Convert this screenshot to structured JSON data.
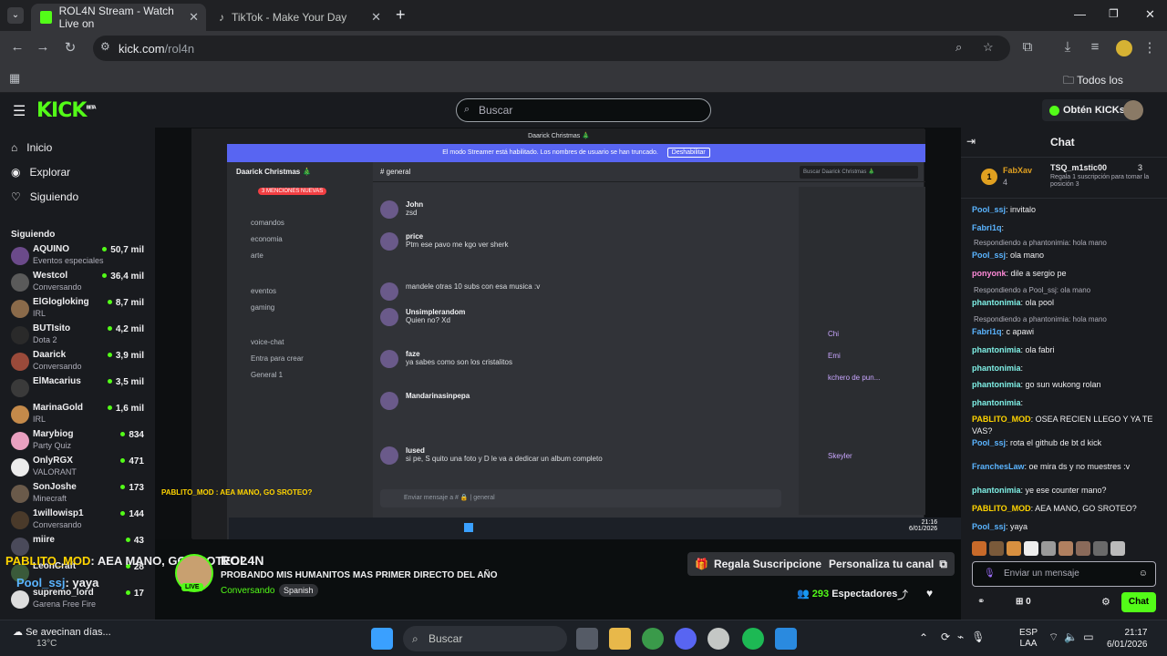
{
  "browser": {
    "tabs": [
      {
        "label": "ROL4N Stream - Watch Live on",
        "icon": "kick-favicon-icon"
      },
      {
        "label": "TikTok - Make Your Day",
        "icon": "tiktok-favicon-icon"
      }
    ],
    "url_host": "kick.com",
    "url_path": "/rol4n",
    "bookmarks_label": "Todos los favoritos"
  },
  "header": {
    "logo": "KICK",
    "beta": "BETA",
    "search_placeholder": "Buscar",
    "kicks_label": "Obtén KICKs"
  },
  "sidebar": {
    "nav": [
      {
        "label": "Inicio",
        "icon": "home-icon"
      },
      {
        "label": "Explorar",
        "icon": "compass-icon"
      },
      {
        "label": "Siguiendo",
        "icon": "heart-icon"
      }
    ],
    "following_title": "Siguiendo",
    "channels": [
      {
        "name": "AQUINO",
        "sub": "Eventos especiales",
        "viewers": "50,7 mil",
        "color": "#6b4a8a"
      },
      {
        "name": "Westcol",
        "sub": "Conversando",
        "viewers": "36,4 mil",
        "color": "#5a5a5a"
      },
      {
        "name": "ElGlogloking",
        "sub": "IRL",
        "viewers": "8,7 mil",
        "color": "#8a6a4a"
      },
      {
        "name": "BUTIsito",
        "sub": "Dota 2",
        "viewers": "4,2 mil",
        "color": "#2a2a2a"
      },
      {
        "name": "Daarick",
        "sub": "Conversando",
        "viewers": "3,9 mil",
        "color": "#9a4a3a"
      },
      {
        "name": "ElMacarius",
        "sub": "",
        "viewers": "3,5 mil",
        "color": "#3a3a3a"
      },
      {
        "name": "MarinaGold",
        "sub": "IRL",
        "viewers": "1,6 mil",
        "color": "#c48a4a"
      },
      {
        "name": "Marybiog",
        "sub": "Party Quiz",
        "viewers": "834",
        "color": "#e9a0c0"
      },
      {
        "name": "OnlyRGX",
        "sub": "VALORANT",
        "viewers": "471",
        "color": "#ececec"
      },
      {
        "name": "SonJoshe",
        "sub": "Minecraft",
        "viewers": "173",
        "color": "#6a5a4a"
      },
      {
        "name": "1willowisp1",
        "sub": "Conversando",
        "viewers": "144",
        "color": "#4a3a2a"
      },
      {
        "name": "miire",
        "sub": "",
        "viewers": "43",
        "color": "#4a4a5a"
      },
      {
        "name": "LeonCraft",
        "sub": "",
        "viewers": "28",
        "color": "#3a5a3a"
      },
      {
        "name": "supremo_lord",
        "sub": "Garena Free Fire",
        "viewers": "17",
        "color": "#dddddd"
      }
    ]
  },
  "discord": {
    "server": "Daarick Christmas 🎄",
    "banner": "El modo Streamer está habilitado. Los nombres de usuario se han truncado.",
    "banner_btn": "Deshabilitar",
    "channel": "general",
    "search": "Buscar Daarick Christmas 🎄",
    "mentions": "3 MENCIONES NUEVAS",
    "channels": [
      "comandos",
      "economia",
      "arte",
      "eventos",
      "gaming",
      "voice-chat",
      "Entra para crear",
      "General 1"
    ],
    "messages": [
      {
        "who": "John",
        "text": "zsd"
      },
      {
        "who": "price",
        "text": "Ptm ese pavo me kgo ver sherk"
      },
      {
        "who": "",
        "text": "mandele otras 10 subs con esa musica :v"
      },
      {
        "who": "Unsimplerandom",
        "text": "Quien no? Xd"
      },
      {
        "who": "faze",
        "text": "ya sabes como son los cristalitos"
      },
      {
        "who": "Mandarinasinpepa",
        "text": ""
      },
      {
        "who": "lused",
        "text": "si pe, S quito una foto y D le va a dedicar un album completo"
      }
    ],
    "input": "Enviar mensaje a # 🔒 | general",
    "members": [
      "Chi",
      "Emi",
      "kchero de pun...",
      "Skeyler"
    ],
    "overlay": "PABLITO_MOD : AEA MANO, GO SROTEO?",
    "clock": "21:16",
    "date": "6/01/2026"
  },
  "stream": {
    "overlay_chat_user": "PABLITO_MOD",
    "overlay_chat_text": ": AEA MANO, GO SROTEO?",
    "overlay_chat_user2": "Pool_ssj",
    "overlay_chat_text2": ": yaya",
    "streamer": "ROL4N",
    "title": "PROBANDO MIS HUMANITOS MAS PRIMER DIRECTO DEL AÑO",
    "category": "Conversando",
    "language": "Spanish",
    "live": "LIVE",
    "viewers": "293",
    "viewers_label": "Espectadores",
    "gift_btn": "Regala Suscripciones",
    "customize_btn": "Personaliza tu canal"
  },
  "chat": {
    "title": "Chat",
    "pinned_user": "FabXav",
    "pinned_count": "4",
    "top_user": "TSQ_m1stic00",
    "top_count": "3",
    "top_text": "Regala 1 suscripción para tomar la posición 3",
    "messages": [
      {
        "user": "Pool_ssj",
        "color": "#5ab4ff",
        "text": ": invitalo",
        "reply": ""
      },
      {
        "user": "Fabri1q",
        "color": "#5ab4ff",
        "text": ":",
        "reply": ""
      },
      {
        "user": "Pool_ssj",
        "color": "#5ab4ff",
        "text": ": ola mano",
        "reply": "Respondiendo a phantonimia: hola mano"
      },
      {
        "user": "ponyonk",
        "color": "#ff8ad8",
        "text": ": dile a sergio pe",
        "reply": ""
      },
      {
        "user": "phantonimia",
        "color": "#7ff0e6",
        "text": ": ola pool",
        "reply": "Respondiendo a Pool_ssj: ola mano"
      },
      {
        "user": "Fabri1q",
        "color": "#5ab4ff",
        "text": ": c apawi",
        "reply": "Respondiendo a phantonimia: hola mano"
      },
      {
        "user": "phantonimia",
        "color": "#7ff0e6",
        "text": ": ola fabri",
        "reply": ""
      },
      {
        "user": "phantonimia",
        "color": "#7ff0e6",
        "text": ":",
        "reply": ""
      },
      {
        "user": "phantonimia",
        "color": "#7ff0e6",
        "text": ": go sun wukong rolan",
        "reply": ""
      },
      {
        "user": "phantonimia",
        "color": "#7ff0e6",
        "text": ":",
        "reply": ""
      },
      {
        "user": "PABLITO_MOD",
        "color": "#ffd400",
        "text": ": OSEA RECIEN LLEGO Y YA TE VAS?",
        "reply": ""
      },
      {
        "user": "Pool_ssj",
        "color": "#5ab4ff",
        "text": ": rota el github de bt d kick",
        "reply": ""
      },
      {
        "user": "FranchesLaw",
        "color": "#5ab4ff",
        "text": ": oe mira ds y no muestres :v",
        "reply": ""
      },
      {
        "user": "phantonimia",
        "color": "#7ff0e6",
        "text": ": ye ese counter mano?",
        "reply": ""
      },
      {
        "user": "PABLITO_MOD",
        "color": "#ffd400",
        "text": ": AEA MANO, GO SROTEO?",
        "reply": ""
      },
      {
        "user": "Pool_ssj",
        "color": "#5ab4ff",
        "text": ": yaya",
        "reply": ""
      }
    ],
    "input_placeholder": "Enviar un mensaje",
    "kicks_count": "0",
    "send": "Chat"
  },
  "taskbar": {
    "weather": "Se avecinan días...",
    "temp": "13°C",
    "search": "Buscar",
    "lang": "ESP",
    "layout": "LAA",
    "time": "21:17",
    "date": "6/01/2026"
  }
}
